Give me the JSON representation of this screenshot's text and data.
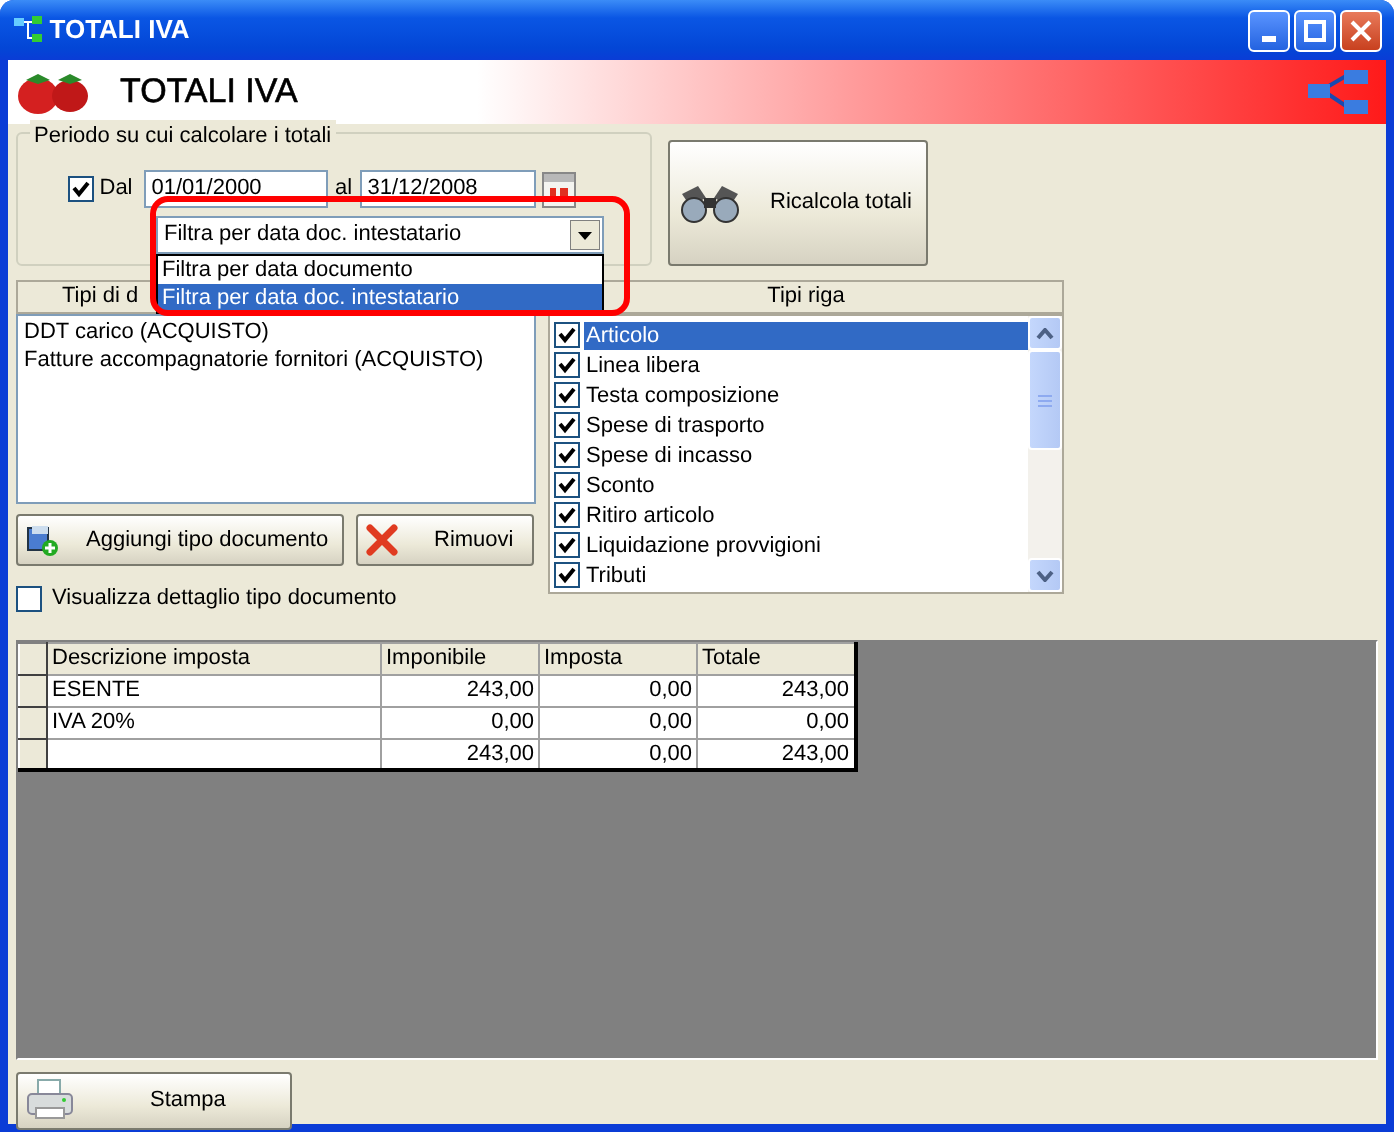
{
  "window": {
    "title": "TOTALI IVA"
  },
  "header": {
    "title": "TOTALI IVA"
  },
  "period": {
    "legend": "Periodo su cui calcolare i totali",
    "enabled": true,
    "from_label": "Dal",
    "from": "01/01/2000",
    "to_label": "al",
    "to": "31/12/2008",
    "filter": {
      "value": "Filtra per data doc. intestatario",
      "expanded": true,
      "options": [
        {
          "label": "Filtra per data documento",
          "selected": false
        },
        {
          "label": "Filtra per data doc. intestatario",
          "selected": true
        }
      ]
    }
  },
  "recalc_button": "Ricalcola totali",
  "doc_types": {
    "header": "Tipi di d",
    "items": [
      "DDT carico (ACQUISTO)",
      "Fatture accompagnatorie fornitori (ACQUISTO)"
    ]
  },
  "row_types": {
    "header": "Tipi riga",
    "items": [
      {
        "label": "Articolo",
        "checked": true,
        "selected": true
      },
      {
        "label": "Linea libera",
        "checked": true,
        "selected": false
      },
      {
        "label": "Testa composizione",
        "checked": true,
        "selected": false
      },
      {
        "label": "Spese di trasporto",
        "checked": true,
        "selected": false
      },
      {
        "label": "Spese di incasso",
        "checked": true,
        "selected": false
      },
      {
        "label": "Sconto",
        "checked": true,
        "selected": false
      },
      {
        "label": "Ritiro articolo",
        "checked": true,
        "selected": false
      },
      {
        "label": "Liquidazione provvigioni",
        "checked": true,
        "selected": false
      },
      {
        "label": "Tributi",
        "checked": true,
        "selected": false
      }
    ]
  },
  "add_button": "Aggiungi tipo documento",
  "remove_button": "Rimuovi",
  "detail_checkbox": {
    "label": "Visualizza dettaglio tipo documento",
    "checked": false
  },
  "table": {
    "columns": [
      "Descrizione imposta",
      "Imponibile",
      "Imposta",
      "Totale"
    ],
    "rows": [
      [
        "ESENTE",
        "243,00",
        "0,00",
        "243,00"
      ],
      [
        "IVA 20%",
        "0,00",
        "0,00",
        "0,00"
      ],
      [
        "",
        "243,00",
        "0,00",
        "243,00"
      ]
    ]
  },
  "print_button": "Stampa"
}
